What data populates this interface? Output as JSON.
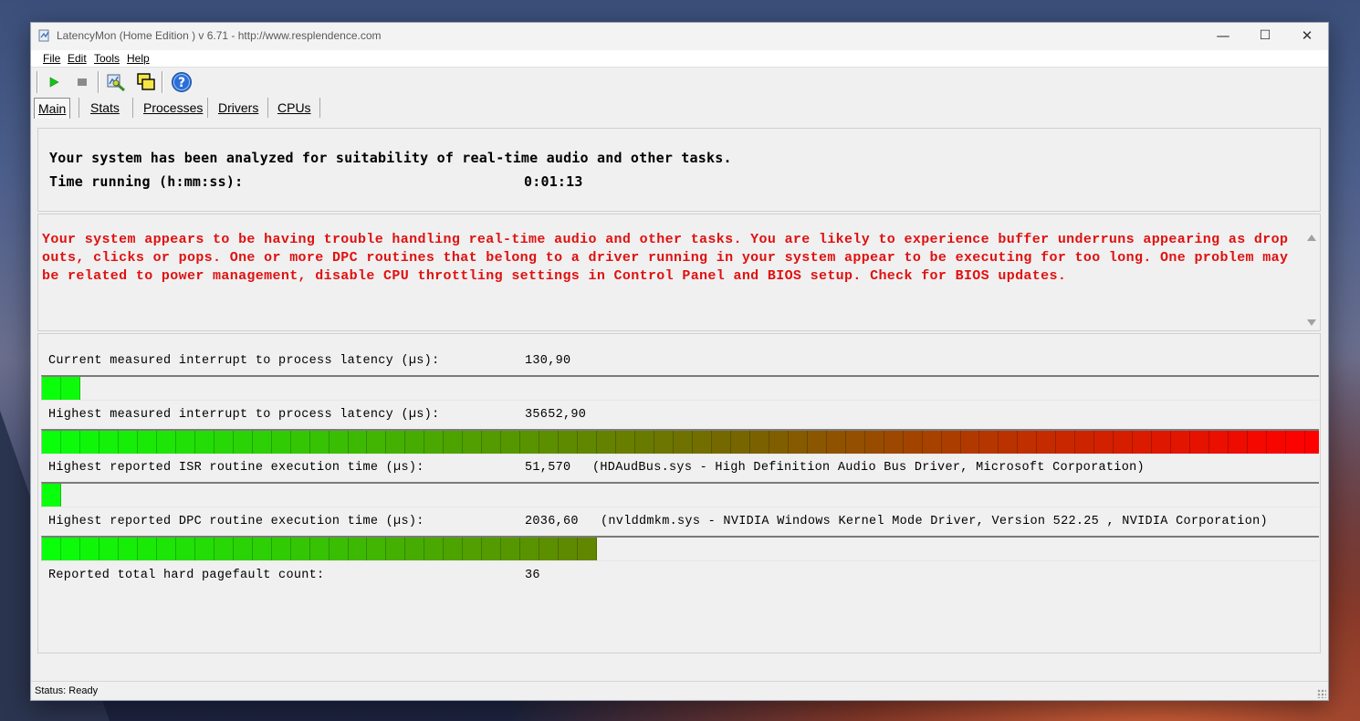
{
  "window": {
    "title": "LatencyMon  (Home Edition )  v 6.71 - http://www.resplendence.com",
    "controls": {
      "minimize": "—",
      "maximize": "☐",
      "close": "✕"
    }
  },
  "menu": [
    "File",
    "Edit",
    "Tools",
    "Help"
  ],
  "toolbar": {
    "icons": [
      "play-icon",
      "stop-icon",
      "analyze-icon",
      "windows-icon",
      "help-icon"
    ],
    "colors": {
      "play": "#16c21a",
      "stop": "#8a8a8a",
      "help": "#2b6fd6"
    }
  },
  "tabs": [
    {
      "label": "Main",
      "active": true
    },
    {
      "label": "Stats",
      "active": false
    },
    {
      "label": "Processes",
      "active": false
    },
    {
      "label": "Drivers",
      "active": false
    },
    {
      "label": "CPUs",
      "active": false
    }
  ],
  "summary": {
    "line1": "Your system has been analyzed for suitability of real-time audio and other tasks.",
    "time_label": "Time running (h:mm:ss):",
    "time_value": "0:01:13"
  },
  "warning": {
    "text": "Your system appears to be having trouble handling real-time audio and other tasks. You are likely to experience buffer underruns appearing as drop outs, clicks or pops. One or more DPC routines that belong to a driver running in your system appear to be executing for too long. One problem may be related to power management, disable CPU throttling settings in Control Panel and BIOS setup. Check for BIOS updates.",
    "color": "#e01010"
  },
  "metrics": [
    {
      "label": "Current measured interrupt to process latency (µs):",
      "value": "130,90",
      "extra": "",
      "bar_level": 0.03
    },
    {
      "label": "Highest measured interrupt to process latency (µs):",
      "value": "35652,90",
      "extra": "",
      "bar_level": 1.0
    },
    {
      "label": "Highest reported ISR routine execution time (µs):",
      "value": "51,570",
      "extra": "(HDAudBus.sys - High Definition Audio Bus Driver, Microsoft Corporation)",
      "bar_level": 0.015
    },
    {
      "label": "Highest reported DPC routine execution time (µs):",
      "value": "2036,60",
      "extra": "(nvlddmkm.sys - NVIDIA Windows Kernel Mode Driver, Version 522.25 , NVIDIA Corporation)",
      "bar_level": 0.44
    }
  ],
  "pagefault": {
    "label": "Reported total hard pagefault count:",
    "value": "36"
  },
  "status": {
    "text": "Status: Ready"
  }
}
